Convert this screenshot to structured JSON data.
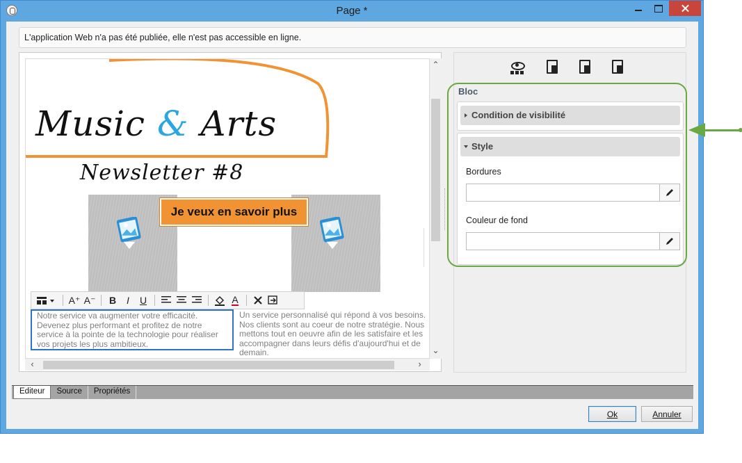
{
  "window": {
    "title": "Page *"
  },
  "info_message": "L'application Web n'a pas été publiée, elle n'est pas accessible en ligne.",
  "canvas": {
    "logo": {
      "part1": "Music ",
      "amp": "&",
      "part2": " Arts"
    },
    "newsletter_title": "Newsletter #8",
    "cta_label": "Je veux en savoir plus",
    "text_left": "Notre service va augmenter votre efficacité. Devenez plus performant et profitez de notre service à la pointe de la technologie pour réaliser vos projets les plus ambitieux.",
    "text_right": "Un service personnalisé qui répond à vos besoins. Nos clients sont au coeur de notre stratégie. Nous mettons tout en oeuvre afin de les satisfaire et les accompagner dans leurs défis d'aujourd'hui et de demain."
  },
  "toolbar": {
    "items": [
      "insert-block-icon",
      "font-increase-icon",
      "font-decrease-icon",
      "bold-icon",
      "italic-icon",
      "underline-icon",
      "align-left-icon",
      "align-center-icon",
      "align-right-icon",
      "fill-color-icon",
      "font-color-icon",
      "remove-icon",
      "link-icon"
    ],
    "bold": "B",
    "italic": "I",
    "underline": "U",
    "font_up": "A⁺",
    "font_down": "A⁻",
    "font_color": "A"
  },
  "properties": {
    "section_title": "Bloc",
    "accordions": {
      "visibility": "Condition de visibilité",
      "style": "Style"
    },
    "fields": {
      "borders_label": "Bordures",
      "borders_value": "",
      "background_label": "Couleur de fond",
      "background_value": ""
    }
  },
  "tabs": [
    "Editeur",
    "Source",
    "Propriétés"
  ],
  "buttons": {
    "ok": "Ok",
    "cancel": "Annuler"
  },
  "colors": {
    "accent_orange": "#f29333",
    "amp_blue": "#2aa7e0",
    "highlight_green": "#6aa843",
    "window_frame": "#5fa7e0"
  }
}
